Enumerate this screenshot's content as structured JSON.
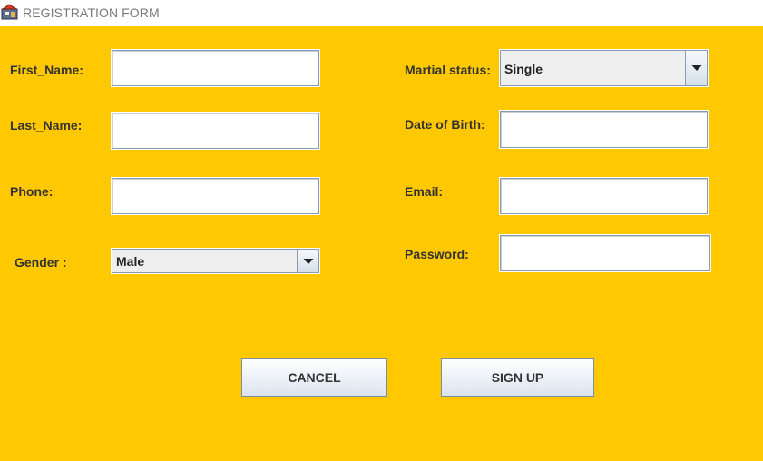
{
  "window": {
    "title": "REGISTRATION FORM",
    "icon": "java-app-icon"
  },
  "colors": {
    "background": "#FFC800",
    "label": "#333333"
  },
  "form": {
    "first_name": {
      "label": "First_Name:",
      "value": ""
    },
    "last_name": {
      "label": "Last_Name:",
      "value": ""
    },
    "phone": {
      "label": "Phone:",
      "value": ""
    },
    "gender": {
      "label": "Gender :",
      "selected": "Male"
    },
    "marital_status": {
      "label": "Martial status:",
      "selected": "Single"
    },
    "date_of_birth": {
      "label": "Date of Birth:",
      "value": ""
    },
    "email": {
      "label": "Email:",
      "value": ""
    },
    "password": {
      "label": "Password:",
      "value": ""
    }
  },
  "buttons": {
    "cancel": "CANCEL",
    "sign_up": "SIGN UP"
  }
}
